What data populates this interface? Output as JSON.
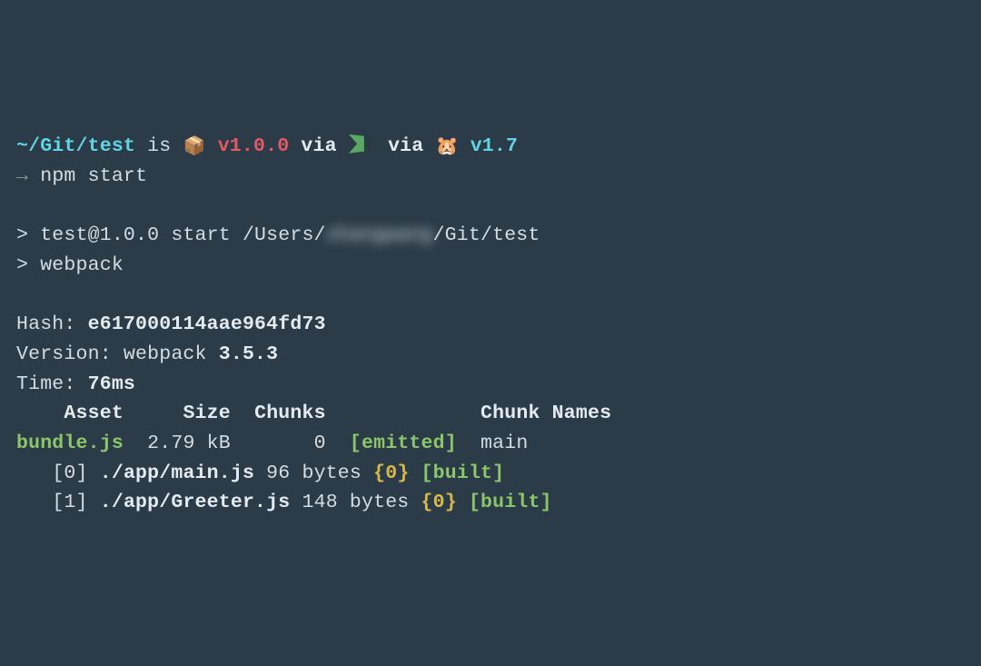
{
  "prompt": {
    "path": "~/Git/test",
    "is": "is",
    "pkg_icon": "📦",
    "pkg_version": "v1.0.0",
    "via1": "via",
    "via2": "via",
    "tool_icon": "🐹",
    "tool_version": "v1.7"
  },
  "command": {
    "arrow": "→",
    "text": "npm start"
  },
  "npm": {
    "line1_a": "> test@1.0.0 start /Users/",
    "line1_redacted": "zhangwang",
    "line1_b": "/Git/test",
    "line2": "> webpack"
  },
  "webpack": {
    "hash_label": "Hash: ",
    "hash": "e617000114aae964fd73",
    "version_label": "Version: webpack ",
    "version": "3.5.3",
    "time_label": "Time: ",
    "time": "76ms",
    "header_asset": "Asset",
    "header_size": "Size",
    "header_chunks": "Chunks",
    "header_chunknames": "Chunk Names",
    "asset_name": "bundle.js",
    "asset_size": "2.79 kB",
    "asset_chunk": "0",
    "asset_status": "[emitted]",
    "asset_chunkname": "main",
    "modules": [
      {
        "idx": "[0]",
        "file": "./app/main.js",
        "size": "96 bytes",
        "chunkref": "{0}",
        "status": "[built]"
      },
      {
        "idx": "[1]",
        "file": "./app/Greeter.js",
        "size": "148 bytes",
        "chunkref": "{0}",
        "status": "[built]"
      }
    ]
  }
}
